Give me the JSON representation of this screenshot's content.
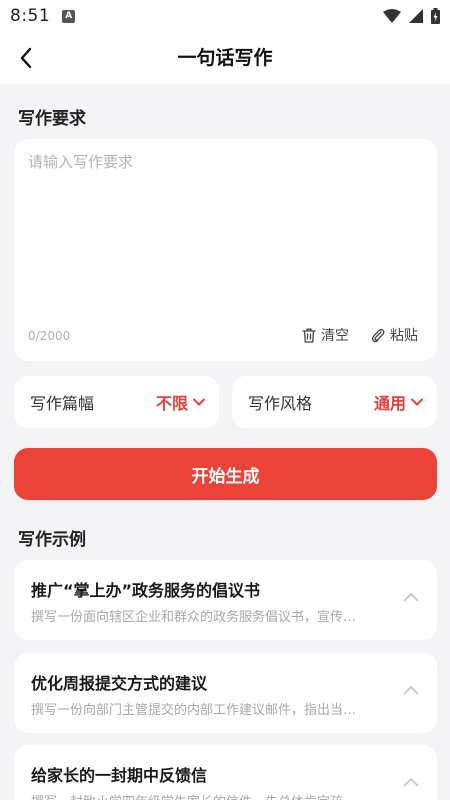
{
  "status_bar": {
    "time": "8:51",
    "app_icon_letter": "A",
    "icons": [
      "wifi-icon",
      "signal-icon",
      "battery-icon"
    ]
  },
  "nav": {
    "title": "一句话写作",
    "back_icon": "back-arrow-icon"
  },
  "requirements": {
    "section_title": "写作要求",
    "placeholder": "请输入写作要求",
    "value": "",
    "counter": "0/2000",
    "clear_label": "清空",
    "paste_label": "粘贴"
  },
  "options": {
    "length_label": "写作篇幅",
    "length_value": "不限",
    "style_label": "写作风格",
    "style_value": "通用"
  },
  "generate_label": "开始生成",
  "examples": {
    "section_title": "写作示例",
    "items": [
      {
        "title": "推广“掌上办”政务服务的倡议书",
        "desc": "撰写一份面向辖区企业和群众的政务服务倡议书，宣传…"
      },
      {
        "title": "优化周报提交方式的建议",
        "desc": "撰写一份向部门主管提交的内部工作建议邮件，指出当…"
      },
      {
        "title": "给家长的一封期中反馈信",
        "desc": "撰写一封致小学四年级学生家长的信件，先总体肯定孩…"
      }
    ]
  },
  "colors": {
    "accent": "#ec4338",
    "accent_text": "#e8403a",
    "background": "#f4f4f6",
    "card": "#ffffff"
  }
}
